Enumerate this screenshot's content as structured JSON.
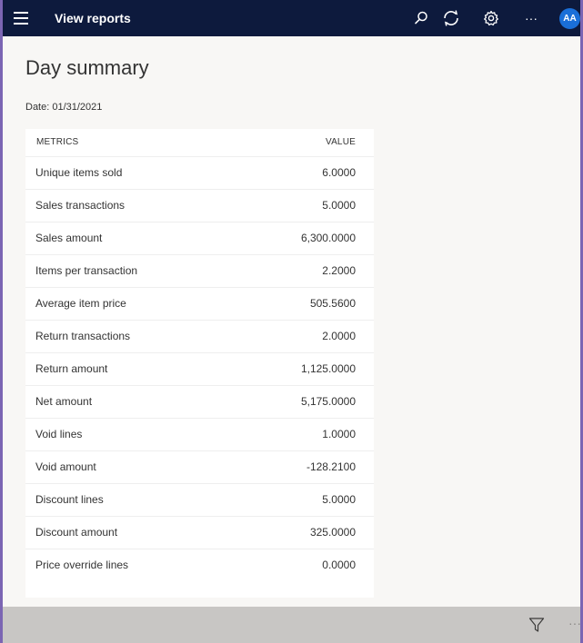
{
  "header": {
    "title": "View reports",
    "menu_icon": "hamburger-icon",
    "search_icon": "search-icon",
    "refresh_icon": "refresh-icon",
    "settings_icon": "gear-icon",
    "more_icon": "more-icon",
    "more_label": "···",
    "avatar_initials": "AA",
    "bg_color": "#0d1a3d",
    "avatar_color": "#1a6fd8"
  },
  "page": {
    "title": "Day summary",
    "date": "Date: 01/31/2021"
  },
  "table": {
    "columns": [
      "METRICS",
      "VALUE"
    ],
    "rows": [
      {
        "metric": "Unique items sold",
        "value": "6.0000"
      },
      {
        "metric": "Sales transactions",
        "value": "5.0000"
      },
      {
        "metric": "Sales amount",
        "value": "6,300.0000"
      },
      {
        "metric": "Items per transaction",
        "value": "2.2000"
      },
      {
        "metric": "Average item price",
        "value": "505.5600"
      },
      {
        "metric": "Return transactions",
        "value": "2.0000"
      },
      {
        "metric": "Return amount",
        "value": "1,125.0000"
      },
      {
        "metric": "Net amount",
        "value": "5,175.0000"
      },
      {
        "metric": "Void lines",
        "value": "1.0000"
      },
      {
        "metric": "Void amount",
        "value": "-128.2100"
      },
      {
        "metric": "Discount lines",
        "value": "5.0000"
      },
      {
        "metric": "Discount amount",
        "value": "325.0000"
      },
      {
        "metric": "Price override lines",
        "value": "0.0000"
      }
    ]
  },
  "footer": {
    "filter_icon": "filter-icon",
    "more_label": "···"
  }
}
